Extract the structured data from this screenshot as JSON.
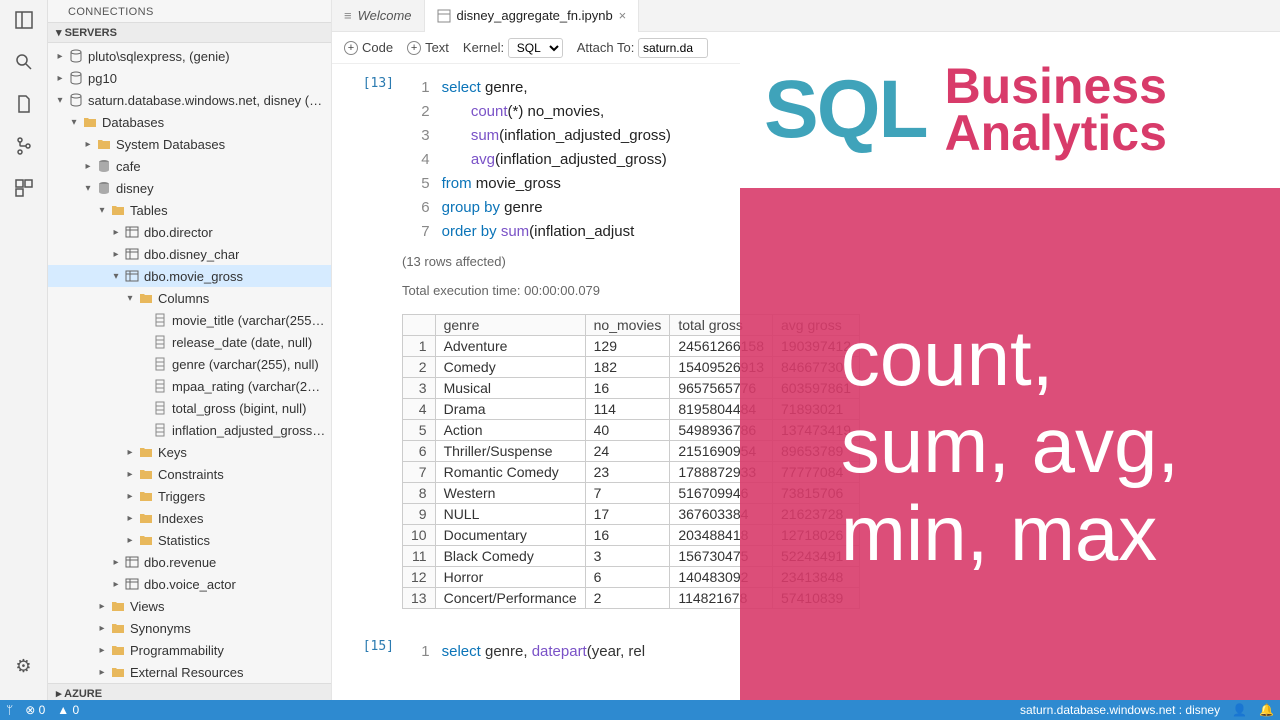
{
  "activitybar": {
    "gear": "⚙"
  },
  "sidebar": {
    "title": "CONNECTIONS",
    "servers_label": "SERVERS",
    "azure_label": "AZURE",
    "servers": [
      {
        "label": "pluto\\sqlexpress, <default> (genie)",
        "type": "server",
        "expanded": false
      },
      {
        "label": "pg10",
        "type": "server",
        "expanded": false
      },
      {
        "label": "saturn.database.windows.net, disney (ap...",
        "type": "server",
        "expanded": true
      }
    ],
    "db_folder": "Databases",
    "children": [
      {
        "label": "System Databases",
        "type": "folder"
      },
      {
        "label": "cafe",
        "type": "db"
      },
      {
        "label": "disney",
        "type": "db",
        "expanded": true
      }
    ],
    "tables_label": "Tables",
    "tables": [
      "dbo.director",
      "dbo.disney_char",
      "dbo.movie_gross",
      "dbo.revenue",
      "dbo.voice_actor"
    ],
    "columns_label": "Columns",
    "columns": [
      "movie_title (varchar(255), null)",
      "release_date (date, null)",
      "genre (varchar(255), null)",
      "mpaa_rating (varchar(255), null)",
      "total_gross (bigint, null)",
      "inflation_adjusted_gross (bigin..."
    ],
    "table_subfolders": [
      "Keys",
      "Constraints",
      "Triggers",
      "Indexes",
      "Statistics"
    ],
    "db_subfolders": [
      "Views",
      "Synonyms",
      "Programmability",
      "External Resources"
    ]
  },
  "tabs": {
    "welcome": "Welcome",
    "file": "disney_aggregate_fn.ipynb"
  },
  "toolbar": {
    "code": "Code",
    "text": "Text",
    "kernel_label": "Kernel:",
    "kernel_value": "SQL",
    "attach_label": "Attach To:",
    "attach_value": "saturn.da"
  },
  "cell13": {
    "prompt": "[13]",
    "lines": [
      [
        {
          "t": "kw",
          "v": "select"
        },
        {
          "t": "id",
          "v": " genre,"
        }
      ],
      [
        {
          "t": "sp",
          "v": "       "
        },
        {
          "t": "fn",
          "v": "count"
        },
        {
          "t": "id",
          "v": "(*) no_movies,"
        }
      ],
      [
        {
          "t": "sp",
          "v": "       "
        },
        {
          "t": "fn",
          "v": "sum"
        },
        {
          "t": "id",
          "v": "(inflation_adjusted_gross)"
        }
      ],
      [
        {
          "t": "sp",
          "v": "       "
        },
        {
          "t": "fn",
          "v": "avg"
        },
        {
          "t": "id",
          "v": "(inflation_adjusted_gross)"
        }
      ],
      [
        {
          "t": "kw",
          "v": "from"
        },
        {
          "t": "id",
          "v": " movie_gross"
        }
      ],
      [
        {
          "t": "kw",
          "v": "group by"
        },
        {
          "t": "id",
          "v": " genre"
        }
      ],
      [
        {
          "t": "kw",
          "v": "order by"
        },
        {
          "t": "sp",
          "v": " "
        },
        {
          "t": "fn",
          "v": "sum"
        },
        {
          "t": "id",
          "v": "(inflation_adjust"
        }
      ]
    ],
    "rows_affected": "(13 rows affected)",
    "exec_time": "Total execution time: 00:00:00.079",
    "headers": [
      "",
      "genre",
      "no_movies",
      "total gross",
      "avg gross"
    ],
    "data": [
      [
        "1",
        "Adventure",
        "129",
        "24561266158",
        "190397412"
      ],
      [
        "2",
        "Comedy",
        "182",
        "15409526913",
        "84667730"
      ],
      [
        "3",
        "Musical",
        "16",
        "9657565776",
        "603597861"
      ],
      [
        "4",
        "Drama",
        "114",
        "8195804484",
        "71893021"
      ],
      [
        "5",
        "Action",
        "40",
        "5498936786",
        "137473419"
      ],
      [
        "6",
        "Thriller/Suspense",
        "24",
        "2151690954",
        "89653789"
      ],
      [
        "7",
        "Romantic Comedy",
        "23",
        "1788872933",
        "77777084"
      ],
      [
        "8",
        "Western",
        "7",
        "516709946",
        "73815706"
      ],
      [
        "9",
        "NULL",
        "17",
        "367603384",
        "21623728"
      ],
      [
        "10",
        "Documentary",
        "16",
        "203488418",
        "12718026"
      ],
      [
        "11",
        "Black Comedy",
        "3",
        "156730475",
        "52243491"
      ],
      [
        "12",
        "Horror",
        "6",
        "140483092",
        "23413848"
      ],
      [
        "13",
        "Concert/Performance",
        "2",
        "114821678",
        "57410839"
      ]
    ]
  },
  "cell15": {
    "prompt": "[15]",
    "line1_a": "select",
    "line1_b": " genre, ",
    "line1_c": "datepart",
    "line1_d": "(year, rel"
  },
  "overlay": {
    "sql": "SQL",
    "ba1": "Business",
    "ba2": "Analytics",
    "body": "count,\nsum, avg,\nmin, max"
  },
  "statusbar": {
    "branch_icon": "ᛘ",
    "errs": "⊗ 0",
    "warns": "▲ 0",
    "conn": "saturn.database.windows.net : disney",
    "bell": "🔔"
  }
}
